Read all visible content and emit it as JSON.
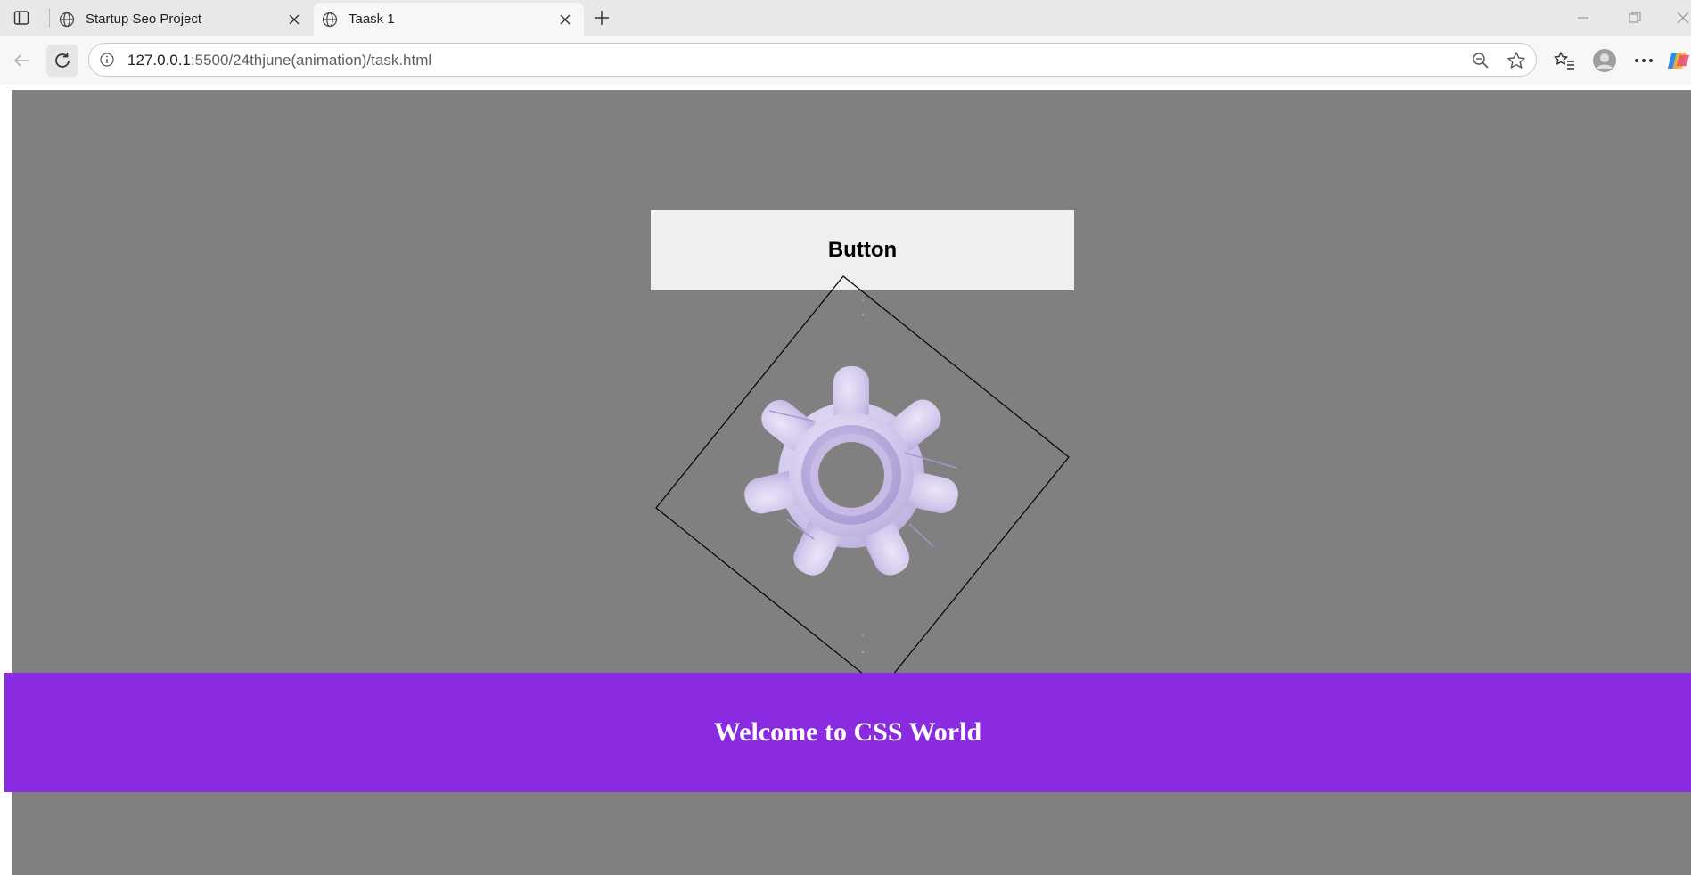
{
  "browser": {
    "tabs": [
      {
        "title": "Startup Seo Project",
        "active": false
      },
      {
        "title": "Taask 1",
        "active": true
      }
    ],
    "address": {
      "host": "127.0.0.1",
      "path": ":5500/24thjune(animation)/task.html"
    },
    "icons": {
      "tab_actions": "tab-actions-icon",
      "favicon": "globe-icon",
      "new_tab": "plus-icon",
      "back": "arrow-left-icon",
      "reload": "reload-icon",
      "site_info": "info-icon",
      "zoom": "zoom-out-icon",
      "favorite": "star-icon",
      "favorites_list": "favorites-icon",
      "profile": "avatar-icon",
      "menu": "more-icon"
    }
  },
  "page": {
    "button_label": "Button",
    "banner_text": "Welcome to CSS World",
    "colors": {
      "background": "#808080",
      "banner": "#8a2be2",
      "button": "#efefef",
      "gear": "#c9bfe6"
    }
  }
}
